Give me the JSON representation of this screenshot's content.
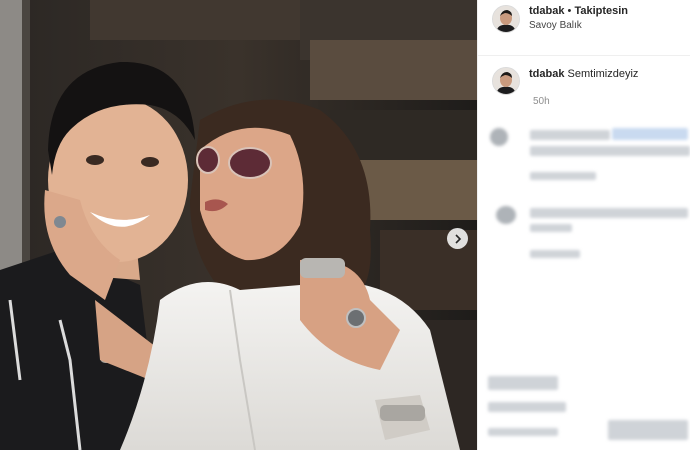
{
  "post_header": {
    "username": "tdabak",
    "separator": " • ",
    "follow_status": "Takiptesin",
    "location": "Savoy Balık"
  },
  "caption": {
    "username": "tdabak",
    "text": "Semtimizdeyiz",
    "timestamp": "50h"
  },
  "icons": {
    "avatar": "profile-avatar-icon",
    "next": "chevron-right-icon"
  },
  "colors": {
    "text": "#262626",
    "muted": "#8e8e8e",
    "border": "#efefef"
  }
}
